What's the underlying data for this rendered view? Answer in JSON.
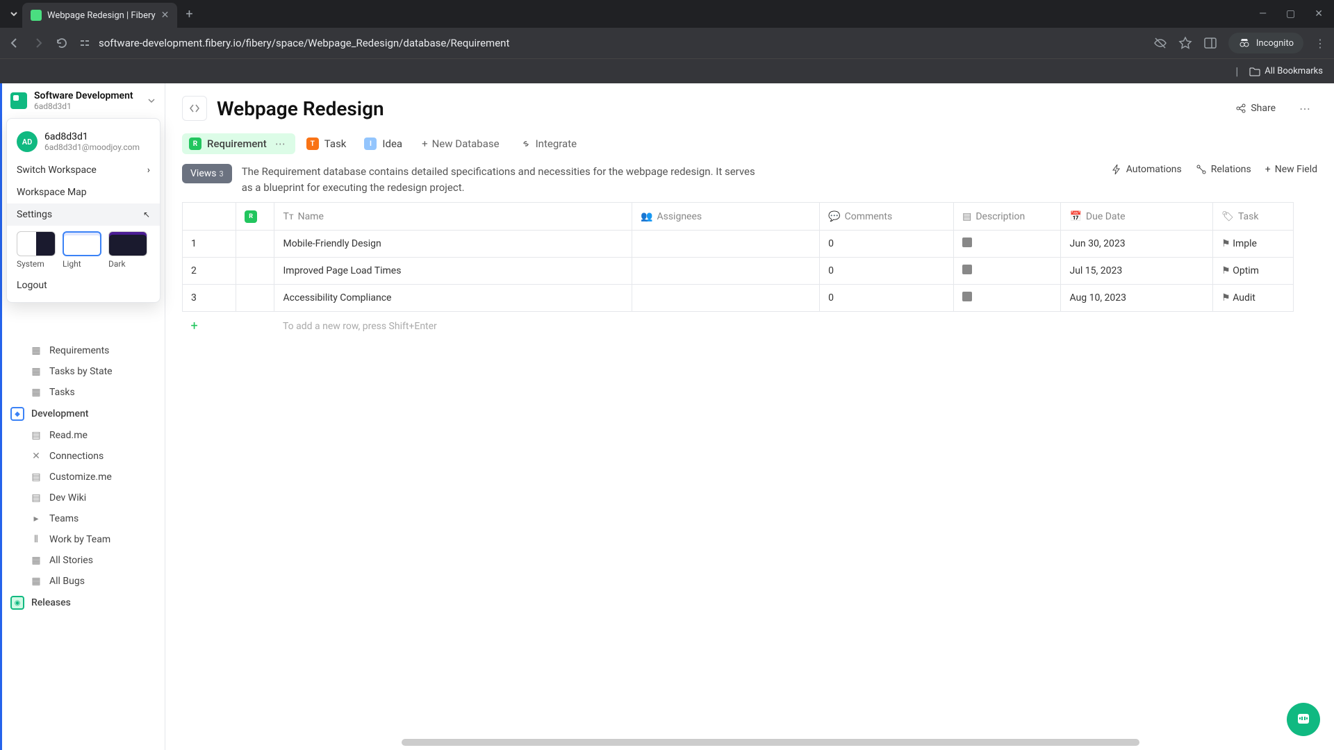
{
  "browser": {
    "tab_title": "Webpage Redesign | Fibery",
    "url": "software-development.fibery.io/fibery/space/Webpage_Redesign/database/Requirement",
    "incognito_label": "Incognito",
    "bookmarks_label": "All Bookmarks"
  },
  "workspace": {
    "name": "Software Development",
    "id": "6ad8d3d1"
  },
  "ws_menu": {
    "avatar_initials": "AD",
    "user_name": "6ad8d3d1",
    "user_email": "6ad8d3d1@moodjoy.com",
    "switch_workspace": "Switch Workspace",
    "workspace_map": "Workspace Map",
    "settings": "Settings",
    "themes": {
      "system": "System",
      "light": "Light",
      "dark": "Dark"
    },
    "logout": "Logout"
  },
  "sidebar": {
    "items": [
      {
        "label": "Requirements",
        "icon": "grid"
      },
      {
        "label": "Tasks by State",
        "icon": "grid"
      },
      {
        "label": "Tasks",
        "icon": "grid"
      }
    ],
    "dev_section": "Development",
    "dev_items": [
      {
        "label": "Read.me",
        "icon": "doc"
      },
      {
        "label": "Connections",
        "icon": "connections"
      },
      {
        "label": "Customize.me",
        "icon": "doc"
      },
      {
        "label": "Dev Wiki",
        "icon": "doc"
      },
      {
        "label": "Teams",
        "icon": "caret"
      },
      {
        "label": "Work by Team",
        "icon": "bars"
      },
      {
        "label": "All Stories",
        "icon": "grid"
      },
      {
        "label": "All Bugs",
        "icon": "grid"
      }
    ],
    "releases_section": "Releases"
  },
  "page": {
    "title": "Webpage Redesign",
    "share": "Share"
  },
  "db_tabs": {
    "requirement": "Requirement",
    "task": "Task",
    "idea": "Idea",
    "new_database": "New Database",
    "integrate": "Integrate"
  },
  "views": {
    "label": "Views",
    "count": "3",
    "description": "The Requirement database contains detailed specifications and necessities for the webpage redesign. It serves as a blueprint for executing the redesign project.",
    "automations": "Automations",
    "relations": "Relations",
    "new_field": "New Field"
  },
  "table": {
    "headers": {
      "name": "Name",
      "assignees": "Assignees",
      "comments": "Comments",
      "description": "Description",
      "due_date": "Due Date",
      "task": "Task"
    },
    "rows": [
      {
        "num": "1",
        "name": "Mobile-Friendly Design",
        "comments": "0",
        "due": "Jun 30, 2023",
        "task": "Imple"
      },
      {
        "num": "2",
        "name": "Improved Page Load Times",
        "comments": "0",
        "due": "Jul 15, 2023",
        "task": "Optim"
      },
      {
        "num": "3",
        "name": "Accessibility Compliance",
        "comments": "0",
        "due": "Aug 10, 2023",
        "task": "Audit"
      }
    ],
    "add_row_hint": "To add a new row, press Shift+Enter"
  }
}
